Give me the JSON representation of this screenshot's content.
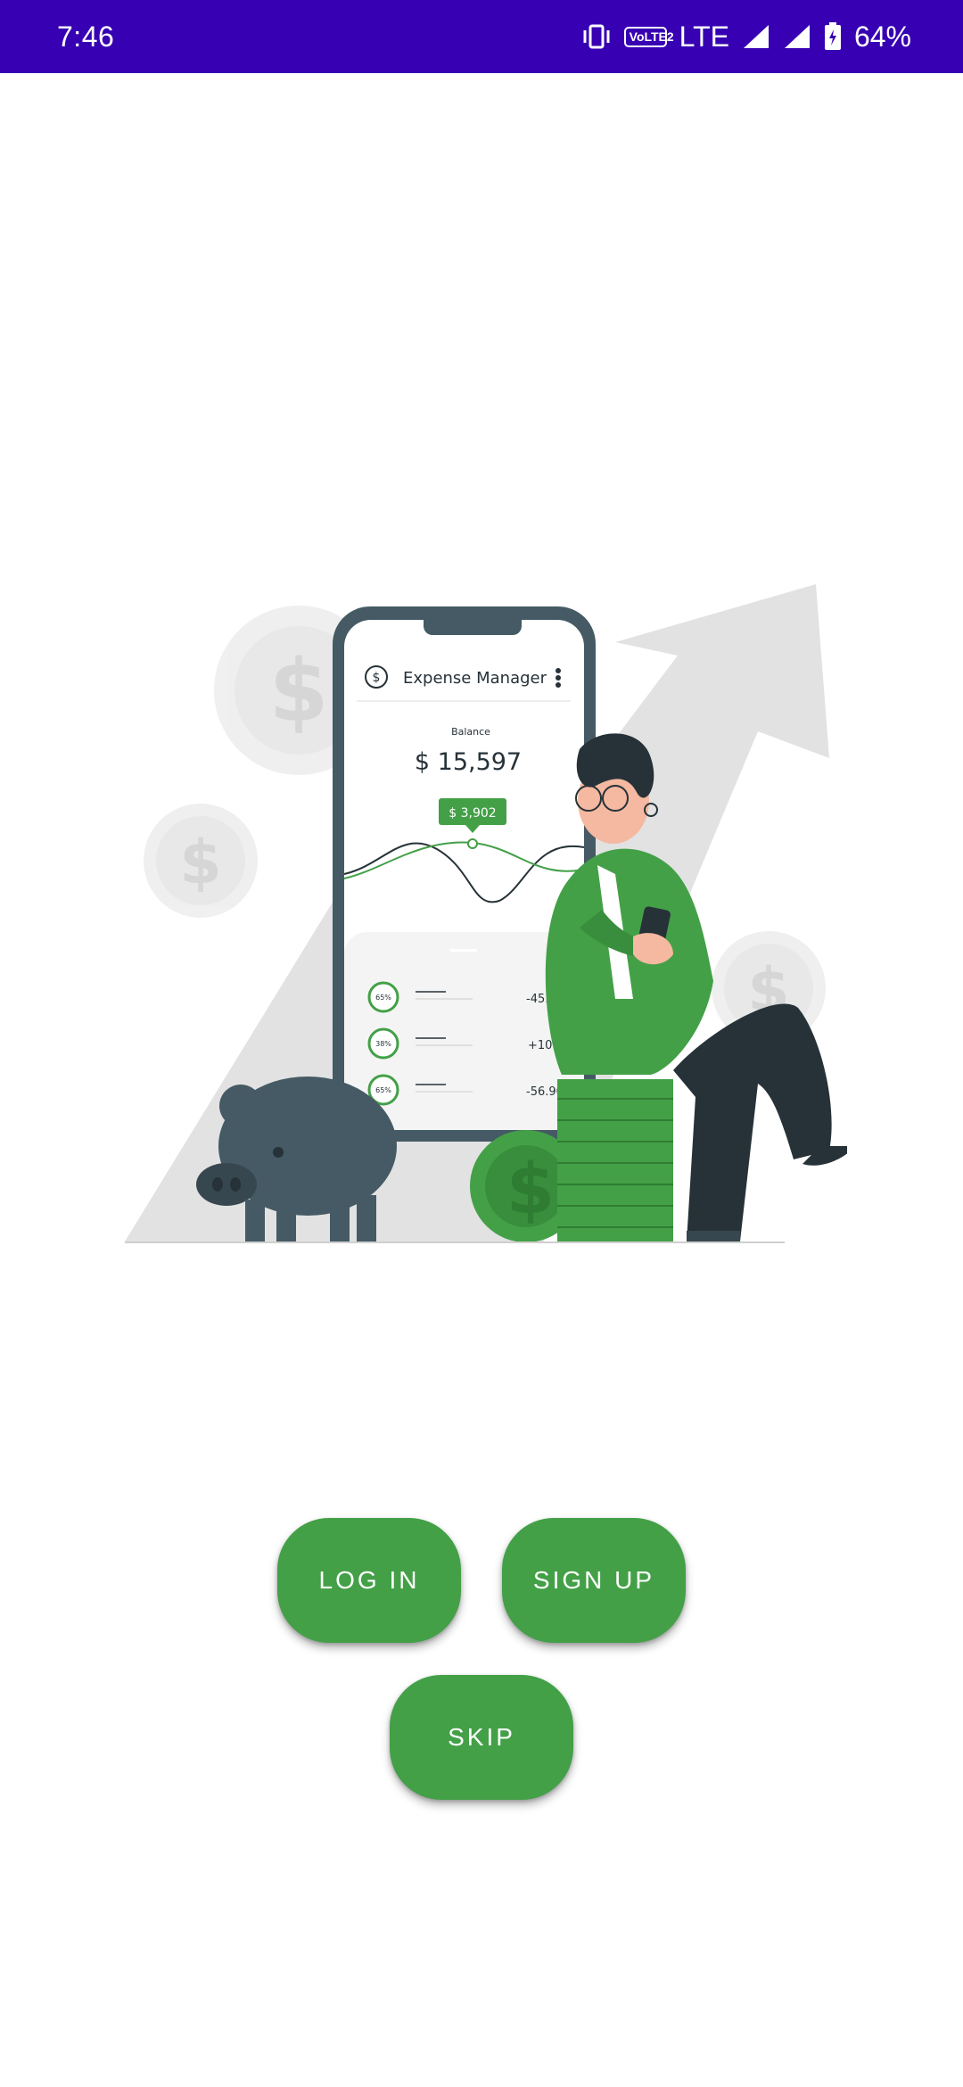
{
  "status_bar": {
    "time": "7:46",
    "volte": "VoLTE2",
    "network": "LTE",
    "battery": "64%",
    "background_color": "#3700B3"
  },
  "illustration": {
    "app_title": "Expense Manager",
    "balance_label": "Balance",
    "balance_value": "$ 15,597",
    "tooltip_value": "$ 3,902",
    "transactions": [
      {
        "percent": "65%",
        "amount": "-45.90"
      },
      {
        "percent": "38%",
        "amount": "+100"
      },
      {
        "percent": "65%",
        "amount": "-56.90"
      }
    ]
  },
  "buttons": {
    "login": "LOG IN",
    "signup": "SIGN UP",
    "skip": "SKIP",
    "color": "#43A047"
  }
}
